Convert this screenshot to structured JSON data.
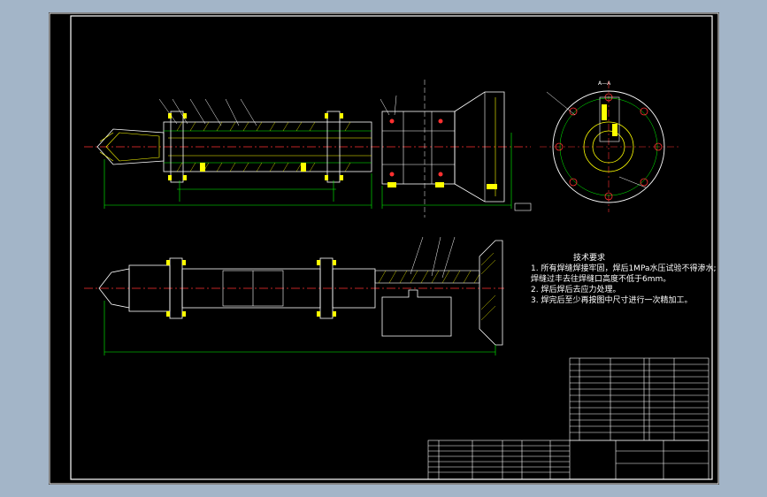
{
  "drawing": {
    "section_label": "A—A",
    "tech_req": {
      "title": "技术要求",
      "items": [
        "1. 所有焊缝焊接牢固，焊后1MPa水压试验不得渗水;",
        "   焊缝过丰去往焊缝口高度不低于6mm。",
        "2. 焊后焊后去应力处理。",
        "3. 焊完后至少再按图中尺寸进行一次精加工。"
      ]
    }
  }
}
